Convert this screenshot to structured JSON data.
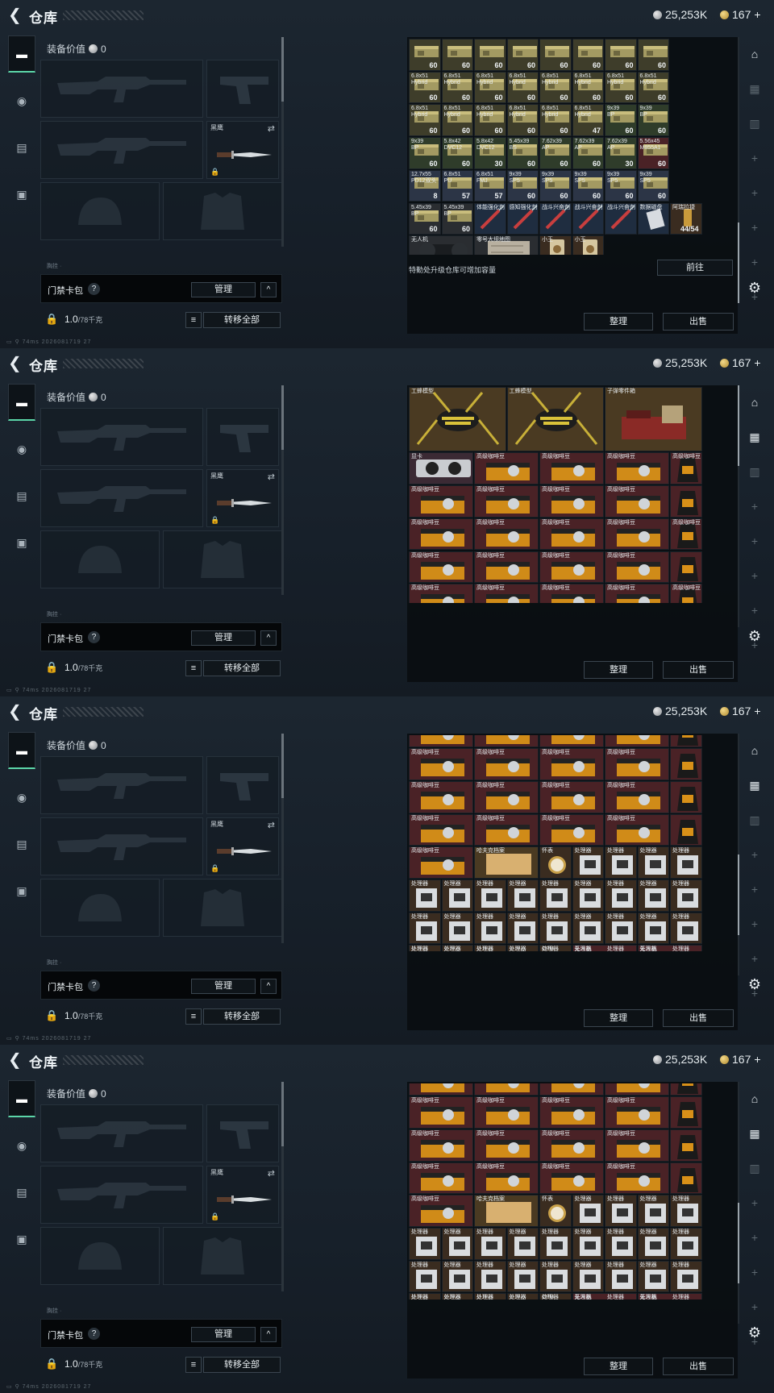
{
  "header": {
    "title": "仓库",
    "silver": "25,253K",
    "gold": "167",
    "gold_plus": "+"
  },
  "equipment": {
    "value_label": "装备价值",
    "value": "0",
    "knife_label": "黑鹰",
    "keycard_label": "门禁卡包",
    "keycard_help": "?",
    "manage_label": "管理",
    "collapse_icon": "^",
    "weight_value": "1.0",
    "weight_max": "/78千克",
    "transfer_all_label": "转移全部",
    "faded_label": "胸挂"
  },
  "footer": {
    "ping": "74ms",
    "build": "2026081719 27"
  },
  "warehouse": {
    "upgrade_hint": "特勤处升级仓库可增加容量",
    "goto_label": "前往",
    "sort_label": "整理",
    "sell_label": "出售"
  },
  "screens": [
    {
      "tiles": [
        {
          "name": "",
          "count": "60",
          "cls": "t-ammo",
          "icon": "ammo"
        },
        {
          "name": "",
          "count": "60",
          "cls": "t-ammo",
          "icon": "ammo"
        },
        {
          "name": "",
          "count": "60",
          "cls": "t-ammo",
          "icon": "ammo"
        },
        {
          "name": "",
          "count": "60",
          "cls": "t-ammo",
          "icon": "ammo"
        },
        {
          "name": "",
          "count": "60",
          "cls": "t-ammo",
          "icon": "ammo"
        },
        {
          "name": "",
          "count": "60",
          "cls": "t-ammo",
          "icon": "ammo"
        },
        {
          "name": "",
          "count": "60",
          "cls": "t-ammo",
          "icon": "ammo"
        },
        {
          "name": "",
          "count": "60",
          "cls": "t-ammo",
          "icon": "ammo"
        },
        {
          "name": "6.8x51\nHybrid",
          "count": "60",
          "cls": "t-ammo",
          "icon": "ammo"
        },
        {
          "name": "6.8x51\nHybrid",
          "count": "60",
          "cls": "t-ammo",
          "icon": "ammo"
        },
        {
          "name": "6.8x51\nHybrid",
          "count": "60",
          "cls": "t-ammo",
          "icon": "ammo"
        },
        {
          "name": "6.8x51\nHybrid",
          "count": "60",
          "cls": "t-ammo",
          "icon": "ammo"
        },
        {
          "name": "6.8x51\nHybrid",
          "count": "60",
          "cls": "t-ammo",
          "icon": "ammo"
        },
        {
          "name": "6.8x51\nHybrid",
          "count": "60",
          "cls": "t-ammo",
          "icon": "ammo"
        },
        {
          "name": "6.8x51\nHybrid",
          "count": "60",
          "cls": "t-ammo",
          "icon": "ammo"
        },
        {
          "name": "6.8x51\nHybrid",
          "count": "60",
          "cls": "t-ammo",
          "icon": "ammo"
        },
        {
          "name": "6.8x51\nHybrid",
          "count": "60",
          "cls": "t-ammo",
          "icon": "ammo"
        },
        {
          "name": "6.8x51\nHybrid",
          "count": "60",
          "cls": "t-ammo",
          "icon": "ammo"
        },
        {
          "name": "6.8x51\nHybrid",
          "count": "60",
          "cls": "t-ammo",
          "icon": "ammo"
        },
        {
          "name": "6.8x51\nHybrid",
          "count": "60",
          "cls": "t-ammo",
          "icon": "ammo"
        },
        {
          "name": "6.8x51\nHybrid",
          "count": "60",
          "cls": "t-ammo",
          "icon": "ammo"
        },
        {
          "name": "6.8x51\nHybrid",
          "count": "47",
          "cls": "t-ammo",
          "icon": "ammo"
        },
        {
          "name": "9x39\nBP",
          "count": "60",
          "cls": "t-amg",
          "icon": "ammo"
        },
        {
          "name": "9x39\nBP",
          "count": "60",
          "cls": "t-amg",
          "icon": "ammo"
        },
        {
          "name": "9x39\nBP",
          "count": "60",
          "cls": "t-amg",
          "icon": "ammo"
        },
        {
          "name": "5.8x42\nDVC12",
          "count": "60",
          "cls": "t-amg",
          "icon": "ammo"
        },
        {
          "name": "5.8x42\nDVC12",
          "count": "30",
          "cls": "t-amg",
          "icon": "ammo"
        },
        {
          "name": "5.45x39\nBS",
          "count": "60",
          "cls": "t-amg",
          "icon": "ammo"
        },
        {
          "name": "7.62x39\nAP",
          "count": "60",
          "cls": "t-amg",
          "icon": "ammo"
        },
        {
          "name": "7.62x39\nAP",
          "count": "60",
          "cls": "t-amg",
          "icon": "ammo"
        },
        {
          "name": "7.62x39\nAP",
          "count": "30",
          "cls": "t-amg",
          "icon": "ammo"
        },
        {
          "name": "5.56x45\nM855A1",
          "count": "60",
          "cls": "t-red",
          "icon": "ammo"
        },
        {
          "name": "12.7x55\nPD12双头",
          "count": "8",
          "cls": "t-ams",
          "icon": "ammo"
        },
        {
          "name": "6.8x51\nPU",
          "count": "57",
          "cls": "t-ams",
          "icon": "ammo"
        },
        {
          "name": "6.8x51\nFMJ",
          "count": "57",
          "cls": "t-ams",
          "icon": "ammo"
        },
        {
          "name": "9x39\nSP5",
          "count": "60",
          "cls": "t-ams",
          "icon": "ammo"
        },
        {
          "name": "9x39\nSP5",
          "count": "60",
          "cls": "t-ams",
          "icon": "ammo"
        },
        {
          "name": "9x39\nSP5",
          "count": "60",
          "cls": "t-ams",
          "icon": "ammo"
        },
        {
          "name": "9x39\nSP5",
          "count": "60",
          "cls": "t-ams",
          "icon": "ammo"
        },
        {
          "name": "9x39\nSP5",
          "count": "60",
          "cls": "t-ams",
          "icon": "ammo"
        },
        {
          "name": "5.45x39\nBP",
          "count": "60",
          "cls": "t-dark",
          "icon": "ammo"
        },
        {
          "name": "5.45x39\nBP",
          "count": "60",
          "cls": "t-dark",
          "icon": "ammo"
        },
        {
          "name": "体能强化剂",
          "count": "",
          "cls": "t-blu",
          "icon": "syringe"
        },
        {
          "name": "感知强化剂",
          "count": "",
          "cls": "t-blu",
          "icon": "syringe"
        },
        {
          "name": "战斗兴奋剂",
          "count": "",
          "cls": "t-blu",
          "icon": "syringe"
        },
        {
          "name": "战斗兴奋剂",
          "count": "",
          "cls": "t-blu",
          "icon": "syringe"
        },
        {
          "name": "战斗兴奋剂",
          "count": "",
          "cls": "t-blu",
          "icon": "syringe"
        },
        {
          "name": "数据磁盘",
          "count": "",
          "cls": "t-blu",
          "icon": "disk"
        },
        {
          "name": "阿瑞拉捷",
          "count": "44/54",
          "cls": "t-brn",
          "icon": "mag"
        }
      ],
      "wide": [
        {
          "name": "无人机",
          "cls": "t-dark",
          "icon": "drone",
          "w": 2
        },
        {
          "name": "零号大坝地图",
          "cls": "t-dark",
          "icon": "map",
          "w": 2
        },
        {
          "name": "小王",
          "cls": "t-brn",
          "icon": "card",
          "w": 1
        },
        {
          "name": "小王",
          "cls": "t-brn",
          "icon": "card",
          "w": 1
        }
      ]
    }
  ]
}
